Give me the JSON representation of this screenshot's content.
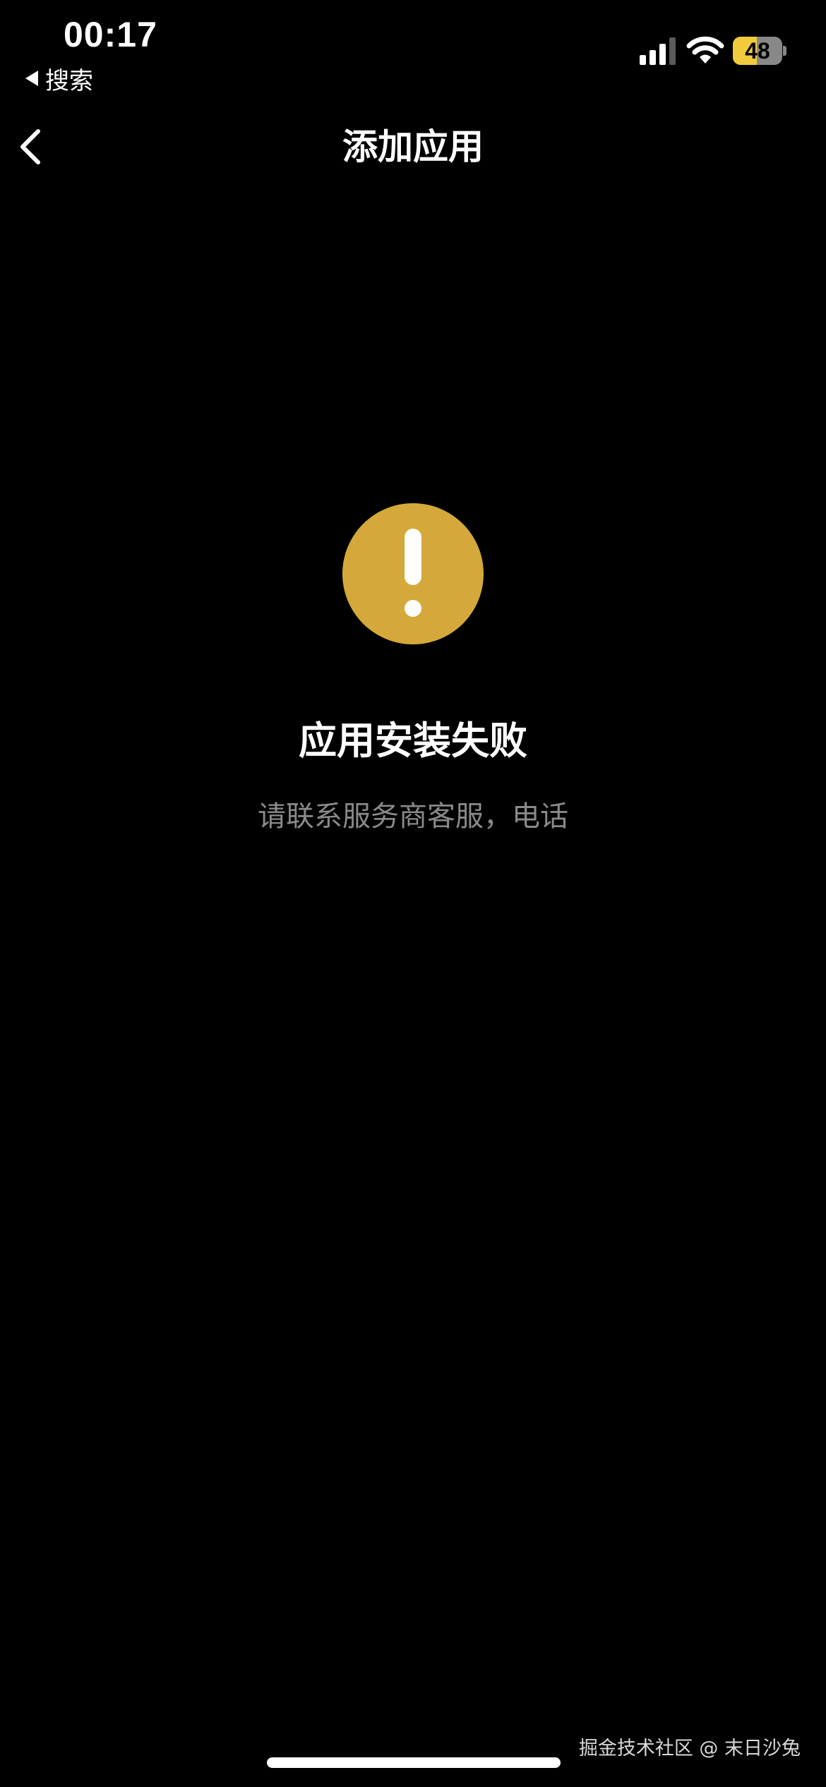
{
  "status_bar": {
    "time": "00:17",
    "back_app_label": "搜索",
    "battery_level": 48,
    "battery_text": "48",
    "battery_color": "#f1cb3d",
    "icons": [
      "cellular-signal-icon",
      "wifi-icon",
      "battery-icon"
    ]
  },
  "nav": {
    "title": "添加应用",
    "back_icon": "chevron-left-icon"
  },
  "main": {
    "alert_icon": "exclamation-circle-icon",
    "alert_color": "#d4a83a",
    "title": "应用安装失败",
    "subtitle": "请联系服务商客服，电话"
  },
  "footer": {
    "watermark": "掘金技术社区 @ 末日沙兔"
  }
}
